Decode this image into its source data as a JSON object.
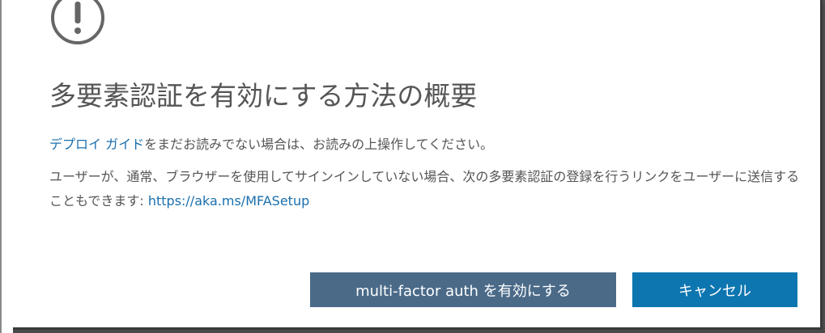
{
  "dialog": {
    "icon": "exclamation-circle-icon",
    "title": "多要素認証を有効にする方法の概要",
    "para1": {
      "link_text": "デプロイ ガイド",
      "rest": "をまだお読みでない場合は、お読みの上操作してください。"
    },
    "para2": {
      "text": "ユーザーが、通常、ブラウザーを使用してサインインしていない場合、次の多要素認証の登録を行うリンクをユーザーに送信することもできます: ",
      "link_text": "https://aka.ms/MFASetup"
    },
    "buttons": {
      "enable_label": "multi-factor auth を有効にする",
      "cancel_label": "キャンセル"
    }
  },
  "colors": {
    "title_text": "#555555",
    "link": "#1a6fae",
    "enable_button": "#4a6a88",
    "cancel_button": "#0d76b0",
    "icon_stroke": "#666666"
  }
}
